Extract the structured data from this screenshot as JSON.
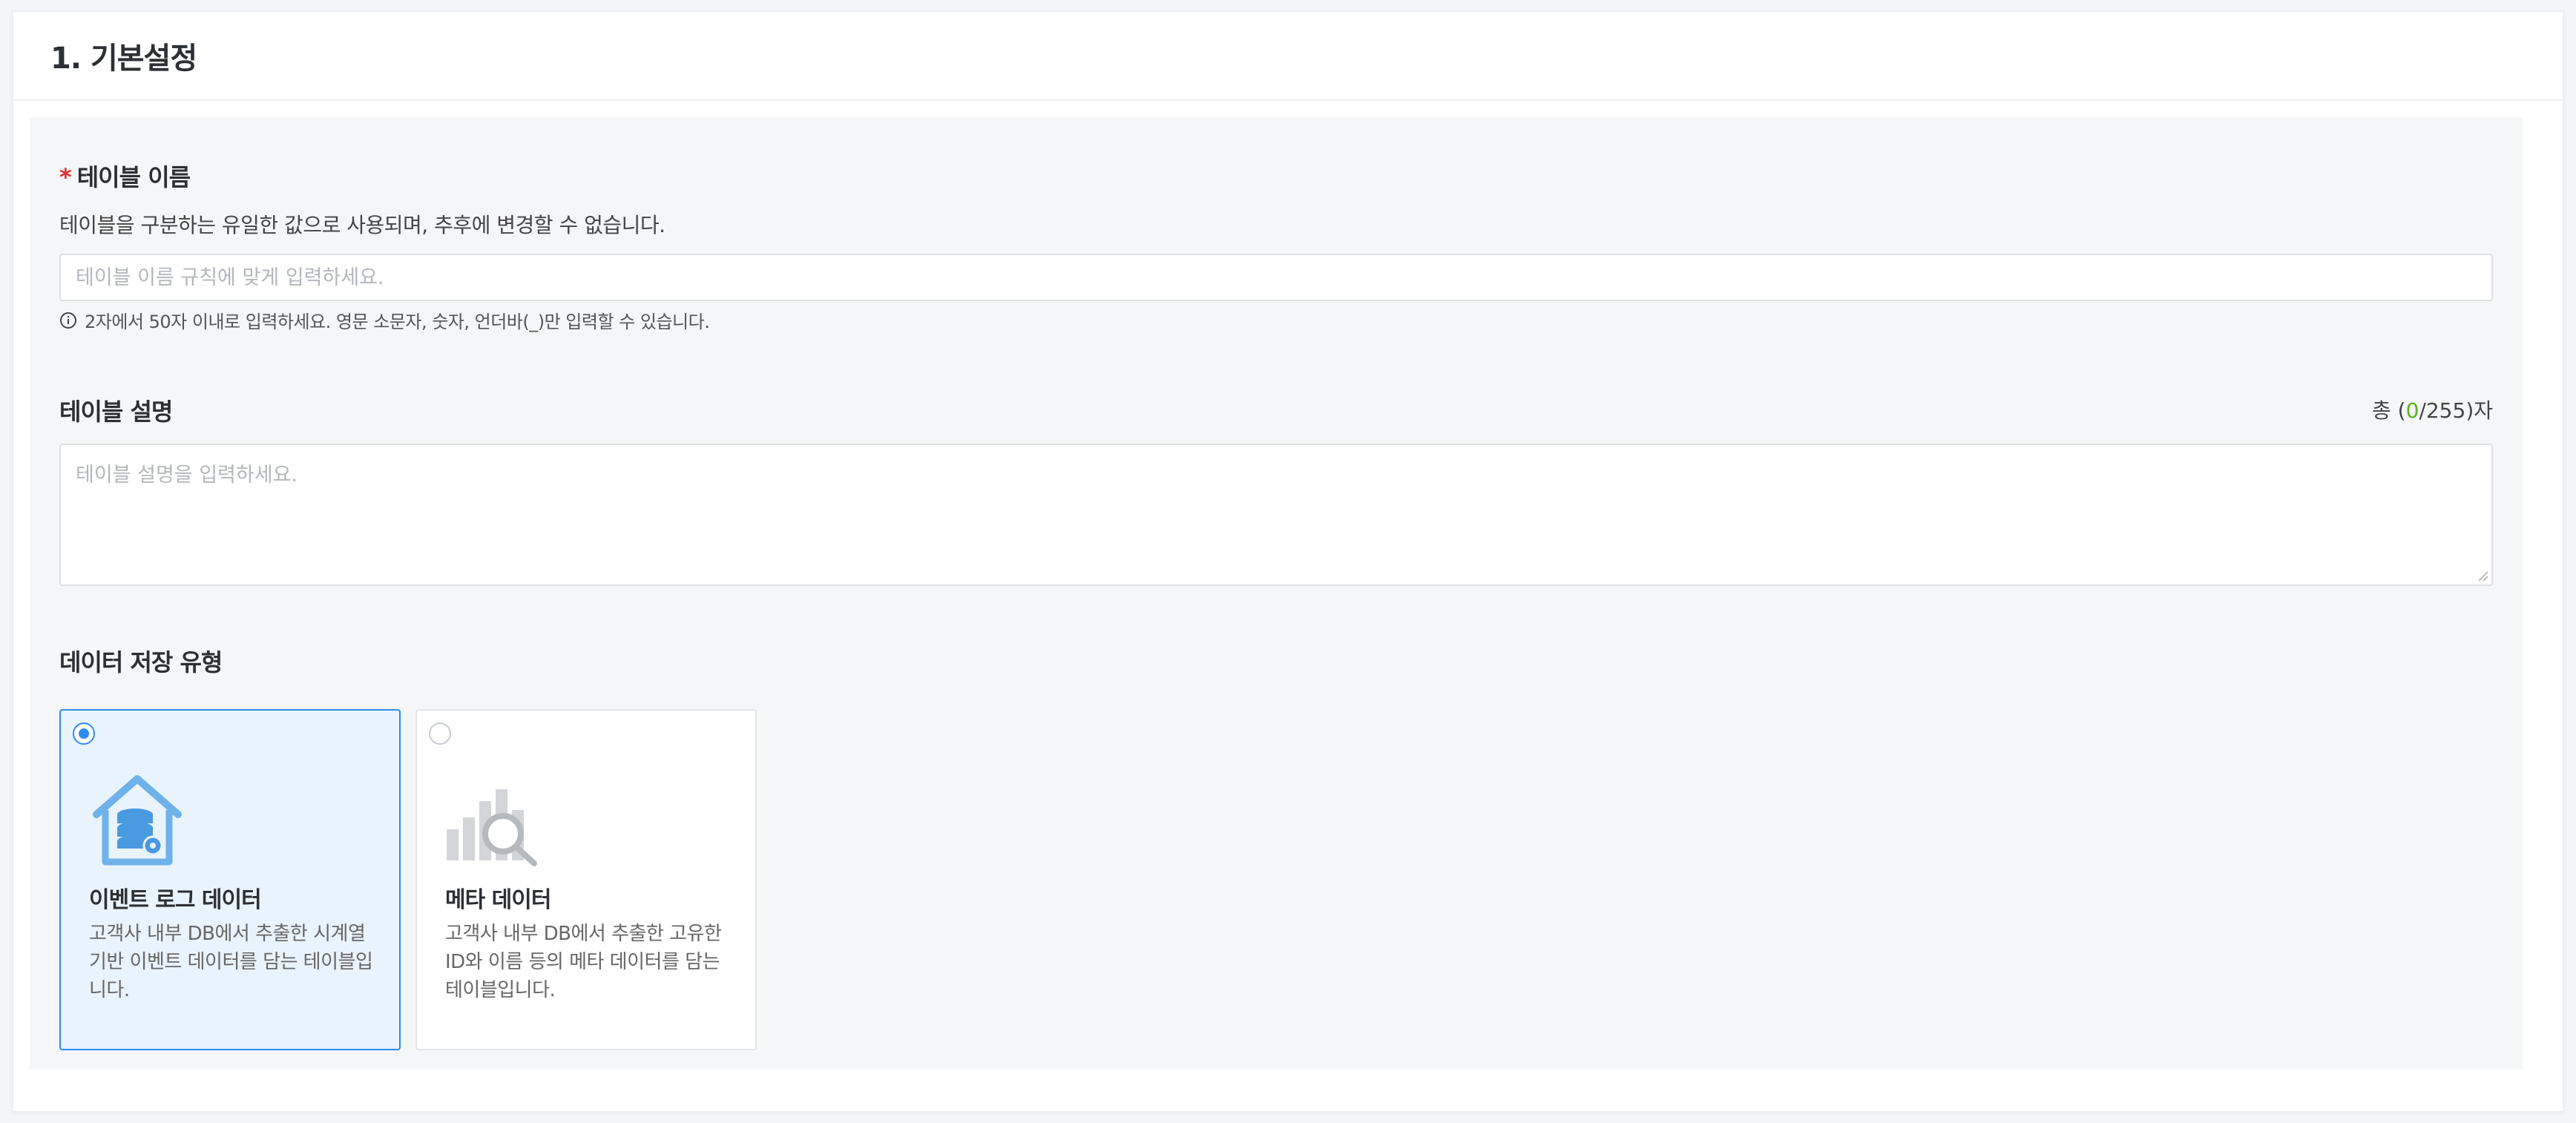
{
  "section": {
    "title": "1. 기본설정"
  },
  "table_name": {
    "required_mark": "*",
    "label": "테이블 이름",
    "description": "테이블을 구분하는 유일한 값으로 사용되며, 추후에 변경할 수 없습니다.",
    "placeholder": "테이블 이름 규칙에 맞게 입력하세요.",
    "value": "",
    "hint": "2자에서 50자 이내로 입력하세요. 영문 소문자, 숫자, 언더바(_)만 입력할 수 있습니다."
  },
  "table_description": {
    "label": "테이블 설명",
    "counter_prefix": "총 (",
    "count": "0",
    "counter_suffix": "/255)자",
    "placeholder": "테이블 설명을 입력하세요.",
    "value": ""
  },
  "storage_type": {
    "label": "데이터 저장 유형",
    "options": [
      {
        "title": "이벤트 로그 데이터",
        "description": "고객사 내부 DB에서 추출한 시계열 기반 이벤트 데이터를 담는 테이블입니다.",
        "selected": true,
        "icon": "database-house-icon"
      },
      {
        "title": "메타 데이터",
        "description": "고객사 내부 DB에서 추출한 고유한 ID와 이름 등의 메타 데이터를 담는 테이블입니다.",
        "selected": false,
        "icon": "chart-magnifier-icon"
      }
    ]
  },
  "colors": {
    "accent": "#2d8cf0",
    "required": "#e0322e",
    "count": "#5bb318"
  }
}
